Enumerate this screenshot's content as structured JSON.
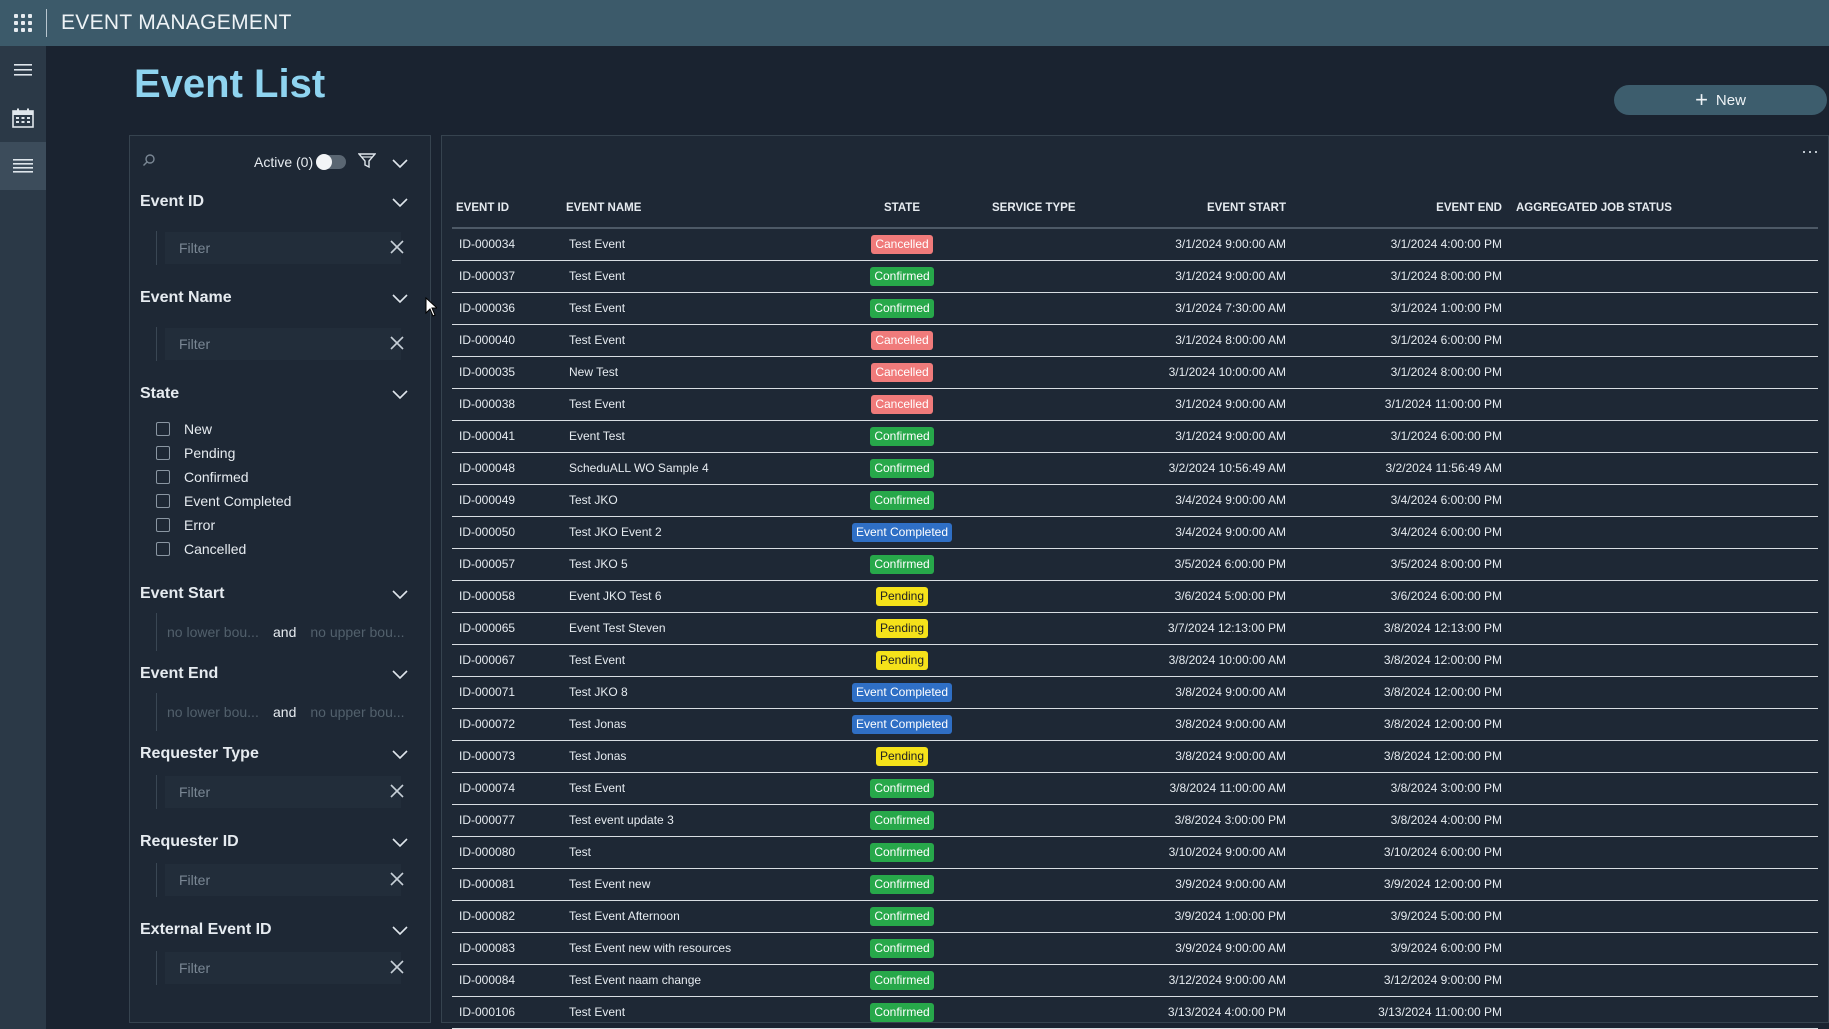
{
  "app": {
    "title": "EVENT MANAGEMENT"
  },
  "icons": {
    "apps": "apps-grid-icon",
    "menu": "hamburger-menu-icon",
    "calendar": "calendar-icon",
    "list": "list-icon",
    "search": "search-icon",
    "filter": "funnel-filter-icon",
    "more": "more-dots-icon"
  },
  "page": {
    "title": "Event List",
    "new_button": "New"
  },
  "filters": {
    "active_label": "Active (0)",
    "event_id": {
      "label": "Event ID",
      "placeholder": "Filter"
    },
    "event_name": {
      "label": "Event Name",
      "placeholder": "Filter"
    },
    "state": {
      "label": "State",
      "options": [
        "New",
        "Pending",
        "Confirmed",
        "Event Completed",
        "Error",
        "Cancelled"
      ]
    },
    "event_start": {
      "label": "Event Start",
      "lower": "no lower bou...",
      "and": "and",
      "upper": "no upper bou..."
    },
    "event_end": {
      "label": "Event End",
      "lower": "no lower bou...",
      "and": "and",
      "upper": "no upper bou..."
    },
    "requester_type": {
      "label": "Requester Type",
      "placeholder": "Filter"
    },
    "requester_id": {
      "label": "Requester ID",
      "placeholder": "Filter"
    },
    "external_event_id": {
      "label": "External Event ID",
      "placeholder": "Filter"
    }
  },
  "table": {
    "columns": [
      "EVENT ID",
      "EVENT NAME",
      "STATE",
      "SERVICE TYPE",
      "EVENT START",
      "EVENT END",
      "AGGREGATED JOB STATUS"
    ],
    "state_colors": {
      "Cancelled": "#f07b7b",
      "Confirmed": "#27a84a",
      "Pending": "#f5e21a",
      "Event Completed": "#2f6fc5"
    },
    "rows": [
      [
        "ID-000034",
        "Test Event",
        "Cancelled",
        "",
        "3/1/2024 9:00:00 AM",
        "3/1/2024 4:00:00 PM",
        ""
      ],
      [
        "ID-000037",
        "Test Event",
        "Confirmed",
        "",
        "3/1/2024 9:00:00 AM",
        "3/1/2024 8:00:00 PM",
        ""
      ],
      [
        "ID-000036",
        "Test Event",
        "Confirmed",
        "",
        "3/1/2024 7:30:00 AM",
        "3/1/2024 1:00:00 PM",
        ""
      ],
      [
        "ID-000040",
        "Test Event",
        "Cancelled",
        "",
        "3/1/2024 8:00:00 AM",
        "3/1/2024 6:00:00 PM",
        ""
      ],
      [
        "ID-000035",
        "New Test",
        "Cancelled",
        "",
        "3/1/2024 10:00:00 AM",
        "3/1/2024 8:00:00 PM",
        ""
      ],
      [
        "ID-000038",
        "Test Event",
        "Cancelled",
        "",
        "3/1/2024 9:00:00 AM",
        "3/1/2024 11:00:00 PM",
        ""
      ],
      [
        "ID-000041",
        "Event Test",
        "Confirmed",
        "",
        "3/1/2024 9:00:00 AM",
        "3/1/2024 6:00:00 PM",
        ""
      ],
      [
        "ID-000048",
        "ScheduALL WO Sample 4",
        "Confirmed",
        "",
        "3/2/2024 10:56:49 AM",
        "3/2/2024 11:56:49 AM",
        ""
      ],
      [
        "ID-000049",
        "Test JKO",
        "Confirmed",
        "",
        "3/4/2024 9:00:00 AM",
        "3/4/2024 6:00:00 PM",
        ""
      ],
      [
        "ID-000050",
        "Test JKO Event 2",
        "Event Completed",
        "",
        "3/4/2024 9:00:00 AM",
        "3/4/2024 6:00:00 PM",
        ""
      ],
      [
        "ID-000057",
        "Test JKO 5",
        "Confirmed",
        "",
        "3/5/2024 6:00:00 PM",
        "3/5/2024 8:00:00 PM",
        ""
      ],
      [
        "ID-000058",
        "Event JKO Test 6",
        "Pending",
        "",
        "3/6/2024 5:00:00 PM",
        "3/6/2024 6:00:00 PM",
        ""
      ],
      [
        "ID-000065",
        "Event Test Steven",
        "Pending",
        "",
        "3/7/2024 12:13:00 PM",
        "3/8/2024 12:13:00 PM",
        ""
      ],
      [
        "ID-000067",
        "Test Event",
        "Pending",
        "",
        "3/8/2024 10:00:00 AM",
        "3/8/2024 12:00:00 PM",
        ""
      ],
      [
        "ID-000071",
        "Test JKO 8",
        "Event Completed",
        "",
        "3/8/2024 9:00:00 AM",
        "3/8/2024 12:00:00 PM",
        ""
      ],
      [
        "ID-000072",
        "Test Jonas",
        "Event Completed",
        "",
        "3/8/2024 9:00:00 AM",
        "3/8/2024 12:00:00 PM",
        ""
      ],
      [
        "ID-000073",
        "Test Jonas",
        "Pending",
        "",
        "3/8/2024 9:00:00 AM",
        "3/8/2024 12:00:00 PM",
        ""
      ],
      [
        "ID-000074",
        "Test Event",
        "Confirmed",
        "",
        "3/8/2024 11:00:00 AM",
        "3/8/2024 3:00:00 PM",
        ""
      ],
      [
        "ID-000077",
        "Test event update 3",
        "Confirmed",
        "",
        "3/8/2024 3:00:00 PM",
        "3/8/2024 4:00:00 PM",
        ""
      ],
      [
        "ID-000080",
        "Test",
        "Confirmed",
        "",
        "3/10/2024 9:00:00 AM",
        "3/10/2024 6:00:00 PM",
        ""
      ],
      [
        "ID-000081",
        "Test Event new",
        "Confirmed",
        "",
        "3/9/2024 9:00:00 AM",
        "3/9/2024 12:00:00 PM",
        ""
      ],
      [
        "ID-000082",
        "Test Event Afternoon",
        "Confirmed",
        "",
        "3/9/2024 1:00:00 PM",
        "3/9/2024 5:00:00 PM",
        ""
      ],
      [
        "ID-000083",
        "Test Event new with resources",
        "Confirmed",
        "",
        "3/9/2024 9:00:00 AM",
        "3/9/2024 6:00:00 PM",
        ""
      ],
      [
        "ID-000084",
        "Test Event naam change",
        "Confirmed",
        "",
        "3/12/2024 9:00:00 AM",
        "3/12/2024 9:00:00 PM",
        ""
      ],
      [
        "ID-000106",
        "Test Event",
        "Confirmed",
        "",
        "3/13/2024 4:00:00 PM",
        "3/13/2024 11:00:00 PM",
        ""
      ]
    ]
  }
}
